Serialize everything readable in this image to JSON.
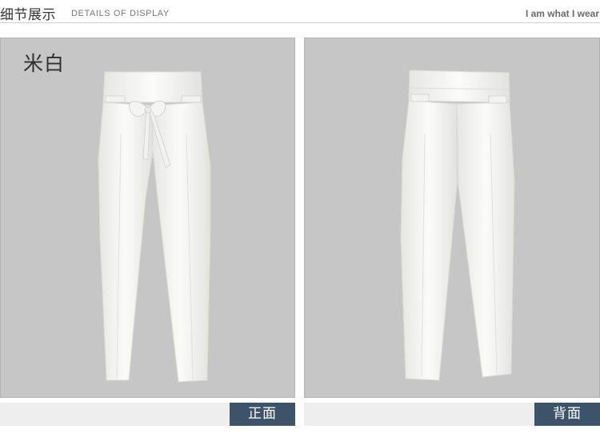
{
  "header": {
    "title_cn": "细节展示",
    "title_en": "DETAILS OF DISPLAY",
    "slogan": "I am what I wear"
  },
  "panels": {
    "front": {
      "color_label": "米白",
      "caption": "正面"
    },
    "back": {
      "caption": "背面"
    }
  },
  "colors": {
    "panel_bg": "#c6c6c6",
    "caption_btn": "#3d5369",
    "garment": "#f7f7f5"
  }
}
